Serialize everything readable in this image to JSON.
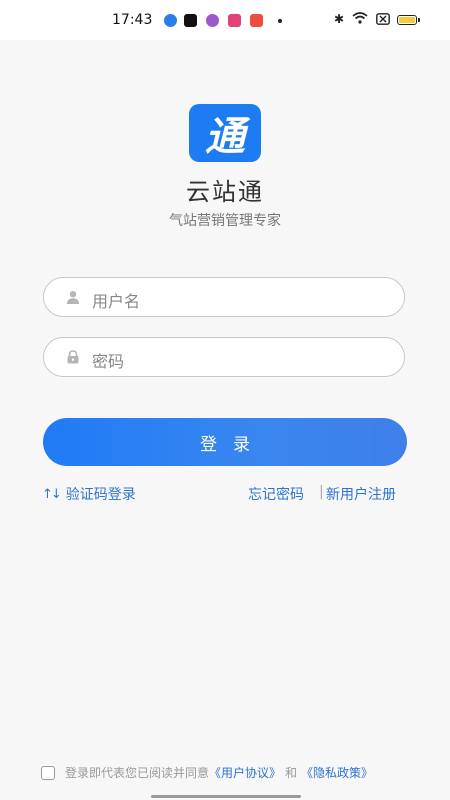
{
  "status_bar": {
    "time": "17:43"
  },
  "app": {
    "logo_char": "通",
    "name": "云站通",
    "slogan": "气站营销管理专家"
  },
  "form": {
    "username_placeholder": "用户名",
    "password_placeholder": "密码",
    "login_button": "登录"
  },
  "links": {
    "sms_login": "验证码登录",
    "forgot_password": "忘记密码",
    "separator": "|",
    "register": "新用户注册"
  },
  "agreement": {
    "prefix": "登录即代表您已阅读并同意",
    "user_agreement": "《用户协议》",
    "and": "和",
    "privacy_policy": "《隐私政策》"
  },
  "colors": {
    "accent": "#1e7cf2",
    "link": "#2f73d0"
  }
}
